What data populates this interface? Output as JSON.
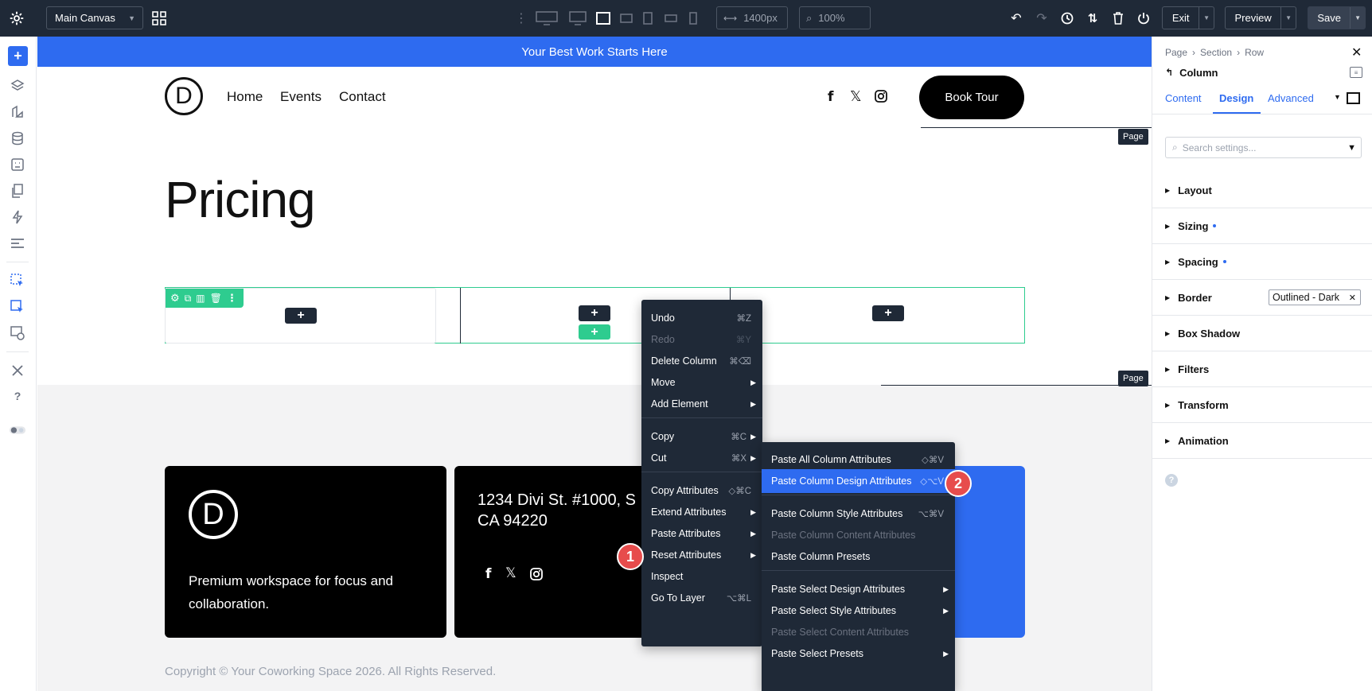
{
  "topbar": {
    "canvas_select": "Main Canvas",
    "width_value": "1400px",
    "zoom_value": "100%",
    "exit_label": "Exit",
    "preview_label": "Preview",
    "save_label": "Save"
  },
  "banner": {
    "text": "Your Best Work Starts Here"
  },
  "nav": {
    "logo_letter": "D",
    "links": [
      "Home",
      "Events",
      "Contact"
    ],
    "cta": "Book Tour"
  },
  "page": {
    "title": "Pricing",
    "page_tag": "Page"
  },
  "footer": {
    "logo_letter": "D",
    "tagline": [
      "Premium workspace for focus and",
      "collaboration."
    ],
    "address": [
      "1234 Divi St. #1000, S",
      "CA 94220"
    ],
    "copyright": "Copyright © Your Coworking Space 2026. All Rights Reserved."
  },
  "context_menu": {
    "items": [
      {
        "label": "Undo",
        "shortcut": "⌘Z"
      },
      {
        "label": "Redo",
        "shortcut": "⌘Y",
        "disabled": true
      },
      {
        "label": "Delete Column",
        "shortcut": "⌘⌫"
      },
      {
        "label": "Move",
        "submenu": true
      },
      {
        "label": "Add Element",
        "submenu": true
      },
      {
        "label": "Copy",
        "shortcut": "⌘C",
        "submenu": true
      },
      {
        "label": "Cut",
        "shortcut": "⌘X",
        "submenu": true
      },
      {
        "label": "Copy Attributes",
        "shortcut": "◇⌘C"
      },
      {
        "label": "Extend Attributes",
        "submenu": true
      },
      {
        "label": "Paste Attributes",
        "submenu": true
      },
      {
        "label": "Reset Attributes",
        "submenu": true
      },
      {
        "label": "Inspect"
      },
      {
        "label": "Go To Layer",
        "shortcut": "⌥⌘L"
      }
    ]
  },
  "submenu": {
    "items": [
      {
        "label": "Paste All Column Attributes",
        "shortcut": "◇⌘V"
      },
      {
        "label": "Paste Column Design Attributes",
        "shortcut": "◇⌥V",
        "highlighted": true
      },
      {
        "label": "Paste Column Style Attributes",
        "shortcut": "⌥⌘V"
      },
      {
        "label": "Paste Column Content Attributes",
        "disabled": true
      },
      {
        "label": "Paste Column Presets"
      },
      {
        "label": "Paste Select Design Attributes",
        "submenu": true
      },
      {
        "label": "Paste Select Style Attributes",
        "submenu": true
      },
      {
        "label": "Paste Select Content Attributes",
        "disabled": true
      },
      {
        "label": "Paste Select Presets",
        "submenu": true
      }
    ]
  },
  "markers": {
    "one": "1",
    "two": "2"
  },
  "panel": {
    "breadcrumb": [
      "Page",
      "Section",
      "Row"
    ],
    "title": "Column",
    "tabs": [
      "Content",
      "Design",
      "Advanced"
    ],
    "active_tab": "Design",
    "search_placeholder": "Search settings...",
    "sections": [
      "Layout",
      "Sizing",
      "Spacing",
      "Border",
      "Box Shadow",
      "Filters",
      "Transform",
      "Animation"
    ],
    "border_preset": "Outlined - Dark",
    "help": "?"
  },
  "colors": {
    "accent": "#2e6bf0",
    "dark": "#1f2937",
    "selection": "#2ecc8f",
    "marker": "#e74c4c"
  }
}
